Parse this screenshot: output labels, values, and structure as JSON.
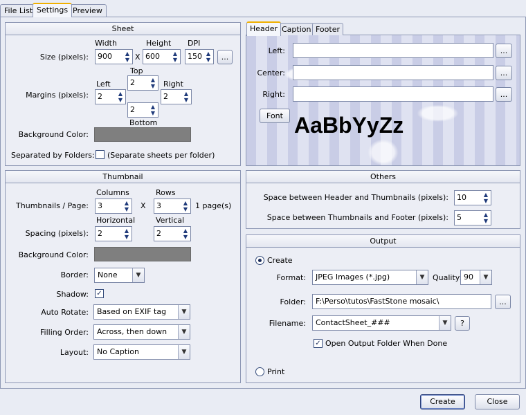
{
  "tabs": [
    "File List",
    "Settings",
    "Preview"
  ],
  "sheet": {
    "title": "Sheet",
    "size_label": "Size (pixels):",
    "width_label": "Width",
    "height_label": "Height",
    "dpi_label": "DPI",
    "width": "900",
    "height": "600",
    "dpi": "150",
    "x": "X",
    "more": "...",
    "margins_label": "Margins (pixels):",
    "top_label": "Top",
    "left_label": "Left",
    "right_label": "Right",
    "bottom_label": "Bottom",
    "top": "2",
    "left": "2",
    "right": "2",
    "bottom": "2",
    "bg_label": "Background Color:",
    "sep_label": "Separated by Folders:",
    "sep_text": "(Separate sheets per folder)"
  },
  "header_panel": {
    "tabs": [
      "Header",
      "Caption",
      "Footer"
    ],
    "left_label": "Left:",
    "center_label": "Center:",
    "right_label": "Right:",
    "font_button": "Font",
    "preview_text": "AaBbYyZz"
  },
  "thumbnail": {
    "title": "Thumbnail",
    "per_page_label": "Thumbnails / Page:",
    "columns_label": "Columns",
    "rows_label": "Rows",
    "columns": "3",
    "rows": "3",
    "x": "X",
    "pages": "1 page(s)",
    "spacing_label": "Spacing (pixels):",
    "horizontal_label": "Horizontal",
    "vertical_label": "Vertical",
    "horizontal": "2",
    "vertical": "2",
    "bg_label": "Background Color:",
    "border_label": "Border:",
    "border_value": "None",
    "shadow_label": "Shadow:",
    "auto_rotate_label": "Auto Rotate:",
    "auto_rotate_value": "Based on EXIF tag",
    "filling_label": "Filling Order:",
    "filling_value": "Across, then down",
    "layout_label": "Layout:",
    "layout_value": "No Caption"
  },
  "others": {
    "title": "Others",
    "space_header_label": "Space between Header and Thumbnails (pixels):",
    "space_header": "10",
    "space_footer_label": "Space between Thumbnails and Footer (pixels):",
    "space_footer": "5"
  },
  "output": {
    "title": "Output",
    "create_label": "Create",
    "format_label": "Format:",
    "format_value": "JPEG Images (*.jpg)",
    "quality_label": "Quality:",
    "quality_value": "90",
    "folder_label": "Folder:",
    "folder_value": "F:\\Perso\\tutos\\FastStone mosaic\\",
    "more": "...",
    "filename_label": "Filename:",
    "filename_value": "ContactSheet_###",
    "help": "?",
    "open_label": "Open Output Folder When Done",
    "print_label": "Print"
  },
  "footer": {
    "create_button": "Create",
    "close_button": "Close"
  }
}
